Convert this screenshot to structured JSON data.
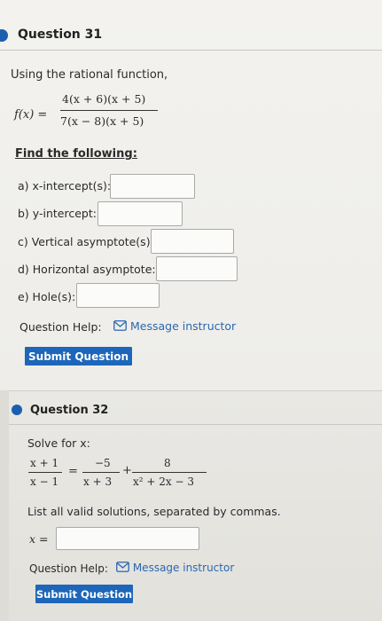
{
  "question31": {
    "title": "Question 31",
    "intro": "Using the rational function,",
    "function_lhs": "f(x) =",
    "numerator": "4(x + 6)(x + 5)",
    "denominator": "7(x − 8)(x + 5)",
    "find_heading": "Find the following:",
    "parts": [
      {
        "label": "a) x-intercept(s):"
      },
      {
        "label": "b) y-intercept:"
      },
      {
        "label": "c) Vertical asymptote(s):"
      },
      {
        "label": "d) Horizontal asymptote:"
      },
      {
        "label": "e) Hole(s):"
      }
    ],
    "help_label": "Question Help:",
    "message_link": "Message instructor",
    "submit_label": "Submit Question"
  },
  "question32": {
    "title": "Question 32",
    "prompt": "Solve for x:",
    "eq": {
      "f1_num": "x + 1",
      "f1_den": "x − 1",
      "equals": "=",
      "f2_num": "−5",
      "f2_den": "x + 3",
      "plus": "+",
      "f3_num": "8",
      "f3_den": "x² + 2x − 3"
    },
    "instruction": "List all valid solutions, separated by commas.",
    "answer_label": "x =",
    "help_label": "Question Help:",
    "message_link": "Message instructor",
    "submit_label": "Submit Question"
  },
  "colors": {
    "accent": "#1d66b9",
    "link": "#2a68b0",
    "status_dot": "#1c5fae"
  },
  "icons": {
    "envelope": "envelope-icon",
    "status": "status-dot-icon"
  }
}
